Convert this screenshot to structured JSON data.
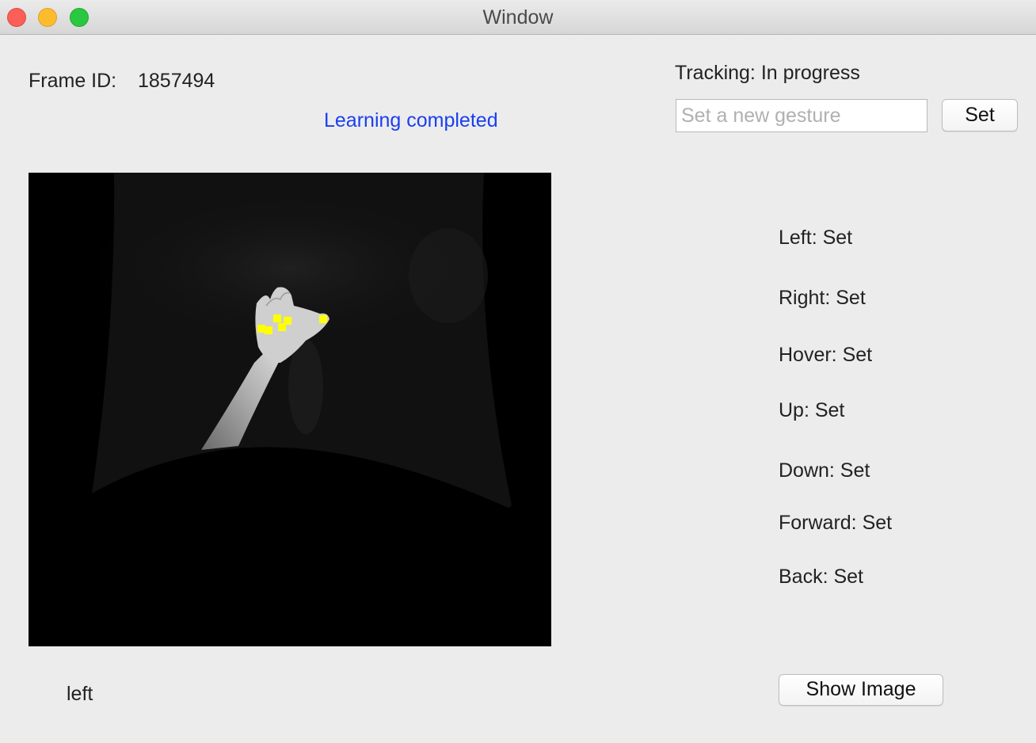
{
  "window": {
    "title": "Window"
  },
  "frame": {
    "label": "Frame ID:",
    "value": "1857494"
  },
  "learning": {
    "status": "Learning completed",
    "color": "#1a3ff0"
  },
  "tracking": {
    "status": "Tracking: In progress"
  },
  "gesture_input": {
    "placeholder": "Set a new gesture",
    "value": ""
  },
  "set_button": {
    "label": "Set"
  },
  "gestures": [
    {
      "label": "Left: Set"
    },
    {
      "label": "Right: Set"
    },
    {
      "label": "Hover: Set"
    },
    {
      "label": "Up: Set"
    },
    {
      "label": "Down: Set"
    },
    {
      "label": "Forward: Set"
    },
    {
      "label": "Back: Set"
    }
  ],
  "detected_gesture": "left",
  "show_image_button": {
    "label": "Show Image"
  },
  "camera_view": {
    "content": "infrared hand image with tracked points",
    "marker_color": "#ffff00"
  }
}
